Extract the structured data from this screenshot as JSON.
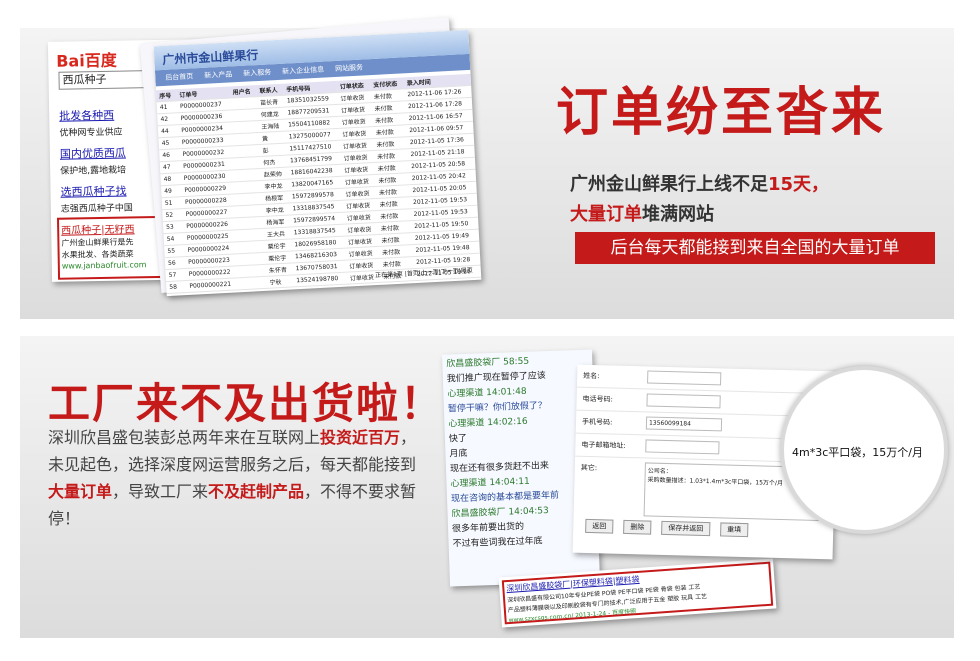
{
  "top_section": {
    "headline": "订单纷至沓来",
    "line1_prefix": "广州金山鲜果行上线不足",
    "line1_highlight": "15天，",
    "line2_highlight": "大量订单",
    "line2_suffix": "堆满网站",
    "banner": "后台每天都能接到来自全国的大量订单"
  },
  "bottom_section": {
    "headline": "工厂来不及出货啦！",
    "para_1": "深圳欣昌盛包装彭总两年来在互联网上",
    "para_hl1": "投资近百万",
    "para_2": "，未见起色，选择深度网运营服务之后，每天都能接到",
    "para_hl2": "大量订单",
    "para_3": "，导致工厂来",
    "para_hl3": "不及赶制产品",
    "para_4": "，不得不要求暂停！"
  },
  "search_screenshot": {
    "logo": "Bai百度",
    "query": "西瓜种子",
    "results": [
      "批发各种西",
      "优种网专业供应",
      "国内优质西瓜",
      "保护地,露地栽培",
      "选西瓜种子找",
      "志强西瓜种子中国",
      "西瓜种子|无籽西",
      "广州金山鲜果行是先",
      "水果批发、各类蔬菜",
      "www.janbaofruit.com"
    ]
  },
  "admin_screenshot": {
    "title": "广州市金山鲜果行",
    "tabs": [
      "后台首页",
      "新入产品",
      "新入服务",
      "新入企业信息",
      "网站服务"
    ],
    "columns": [
      "序号",
      "订单号",
      "用户名",
      "联系人",
      "手机号码",
      "订单状态",
      "支付状态",
      "录入时间"
    ],
    "rows": [
      [
        "41",
        "P0000000237",
        "",
        "苗长青",
        "18351032559",
        "订单收货",
        "未付款",
        "2012-11-06 17:26"
      ],
      [
        "42",
        "P0000000236",
        "",
        "何建龙",
        "18877209531",
        "订单收货",
        "未付款",
        "2012-11-06 17:28"
      ],
      [
        "44",
        "P0000000234",
        "",
        "王海陆",
        "15504110882",
        "订单收货",
        "未付款",
        "2012-11-06 16:57"
      ],
      [
        "45",
        "P0000000233",
        "",
        "黄",
        "13275000077",
        "订单收货",
        "未付款",
        "2012-11-06 09:57"
      ],
      [
        "46",
        "P0000000232",
        "",
        "彭",
        "15117427510",
        "订单收货",
        "未付款",
        "2012-11-05 17:36"
      ],
      [
        "47",
        "P0000000231",
        "",
        "何杰",
        "13768451799",
        "订单收货",
        "未付款",
        "2012-11-05 21:18"
      ],
      [
        "48",
        "P0000000230",
        "",
        "赵荣帅",
        "18816042238",
        "订单收货",
        "未付款",
        "2012-11-05 20:58"
      ],
      [
        "49",
        "P0000000229",
        "",
        "李中龙",
        "13820047165",
        "订单收货",
        "未付款",
        "2012-11-05 20:42"
      ],
      [
        "51",
        "P0000000228",
        "",
        "杨根军",
        "15972899578",
        "订单收货",
        "未付款",
        "2012-11-05 20:05"
      ],
      [
        "52",
        "P0000000227",
        "",
        "李中龙",
        "13318837545",
        "订单收货",
        "未付款",
        "2012-11-05 19:53"
      ],
      [
        "53",
        "P0000000226",
        "",
        "杨海军",
        "15972899574",
        "订单收货",
        "未付款",
        "2012-11-05 19:53"
      ],
      [
        "54",
        "P0000000225",
        "",
        "王大兵",
        "13318837545",
        "订单收货",
        "未付款",
        "2012-11-05 19:50"
      ],
      [
        "55",
        "P0000000224",
        "",
        "粟伦宇",
        "18026958180",
        "订单收货",
        "未付款",
        "2012-11-05 19:49"
      ],
      [
        "56",
        "P0000000223",
        "",
        "粟伦宇",
        "13468216303",
        "订单收货",
        "未付款",
        "2012-11-05 19:48"
      ],
      [
        "57",
        "P0000000222",
        "",
        "朱怀青",
        "13670758031",
        "订单收货",
        "未付款",
        "2012-11-05 19:28"
      ],
      [
        "58",
        "P0000000221",
        "",
        "宁秋",
        "13524198780",
        "订单收货",
        "未付款",
        "2012-11-05 19:26"
      ],
      [
        "59",
        "P0000000220",
        "",
        "庞玲",
        "15024058503",
        "订单收货",
        "未付款",
        "2012-10-15 22:38"
      ]
    ],
    "pager": "正在第1页 |首页|上一页|下一页|尾页"
  },
  "chat_screenshot": {
    "lines": [
      {
        "text": "欣昌盛胶袋厂 58:55",
        "style": "green"
      },
      {
        "text": "我们推广现在暂停了应该",
        "style": "plain"
      },
      {
        "text": "心理渠道 14:01:48",
        "style": "green"
      },
      {
        "text": "暂停干嘛？你们放假了？",
        "style": "blue"
      },
      {
        "text": "心理渠道 14:02:16",
        "style": "green"
      },
      {
        "text": "快了",
        "style": "plain"
      },
      {
        "text": "月底",
        "style": "plain"
      },
      {
        "text": "现在还有很多货赶不出来",
        "style": "plain"
      },
      {
        "text": "心理渠道 14:04:11",
        "style": "green"
      },
      {
        "text": "现在咨询的基本都是要年前",
        "style": "blue"
      },
      {
        "text": "欣昌盛胶袋厂 14:04:53",
        "style": "green"
      },
      {
        "text": "很多年前要出货的",
        "style": "plain"
      },
      {
        "text": "不过有些词我在过年底",
        "style": "plain"
      }
    ],
    "link_title": "深圳欣昌盛胶袋厂|环保塑料袋|塑料袋",
    "link_desc": "深圳欣昌盛有限公司10年专业PE袋 PO袋 PE平口袋 PE袋 骨袋 包装 工艺",
    "link_desc2": "产品塑料薄膜袋以及印刷胶袋有专门的技术,广泛应用于五金 塑胶 玩具 工艺",
    "link_url": "www.szxcsgs.com.cn/ 2013-1-24 - 百度快照"
  },
  "form_screenshot": {
    "labels": [
      "姓名:",
      "电话号码:",
      "手机号码:",
      "电子邮箱地址:",
      "其它:"
    ],
    "phone": "13560099184",
    "note_label": "公司名：",
    "note": "采购数量描述：1.03*1.4m*3c平口袋，15万个/月",
    "buttons": [
      "返回",
      "删除",
      "保存并返回",
      "重填"
    ]
  },
  "magnifier_text": "4m*3c平口袋，15万个/月"
}
